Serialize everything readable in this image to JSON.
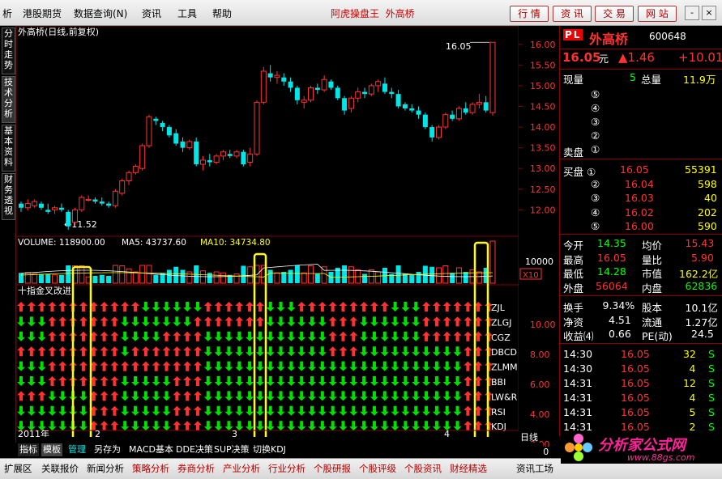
{
  "menu": {
    "items": [
      "析",
      "港股期货",
      "数据查询(N)",
      "资讯",
      "工具",
      "帮助"
    ],
    "title_left": "阿虎操盘王",
    "title_right": "外高桥",
    "buttons": [
      "行 情",
      "资 讯",
      "交 易",
      "网 站"
    ],
    "win_buttons": [
      "-",
      "×"
    ]
  },
  "left_tabs": [
    "分时走势",
    "技术分析",
    "基本资料",
    "财务透视"
  ],
  "chart": {
    "title": "外高桥(日线,前复权)",
    "high_label": "16.05",
    "low_label": "←11.52",
    "price_ticks": [
      "16.00",
      "15.50",
      "15.00",
      "14.50",
      "14.00",
      "13.50",
      "13.00",
      "12.50",
      "12.00"
    ],
    "volume_label": "VOLUME: 118900.00",
    "ma5_label": "MA5: 43737.60",
    "ma10_label": "MA10: 34734.80",
    "volume_tick": "10000",
    "volume_multiplier": "X10",
    "indicator_title": "十指金叉改进",
    "indicator_names": [
      "ZJL",
      "ZLGJ",
      "CGZ",
      "DBCD",
      "ZLMM",
      "BBI",
      "LW&R",
      "RSI",
      "KDJ"
    ],
    "indicator_ticks": [
      "10.00",
      "8.00",
      "6.00",
      "4.00",
      "2.00"
    ],
    "date_year": "2011年",
    "date_marks": [
      "2",
      "3",
      "4"
    ],
    "period": "日线",
    "nav_buttons": [
      "+",
      "-",
      "0"
    ]
  },
  "chart_data": {
    "type": "candlestick",
    "candles": [
      [
        12.15,
        12.2,
        11.95,
        12.05
      ],
      [
        12.05,
        12.25,
        11.98,
        12.15
      ],
      [
        12.1,
        12.25,
        12.05,
        12.2
      ],
      [
        12.15,
        12.2,
        12.0,
        12.05
      ],
      [
        12.0,
        12.15,
        11.9,
        11.95
      ],
      [
        12.0,
        12.1,
        11.9,
        12.05
      ],
      [
        12.05,
        12.15,
        11.95,
        12.0
      ],
      [
        11.95,
        12.0,
        11.52,
        11.6
      ],
      [
        11.7,
        12.05,
        11.65,
        12.0
      ],
      [
        12.0,
        12.35,
        11.95,
        12.3
      ],
      [
        12.25,
        12.35,
        12.2,
        12.25
      ],
      [
        12.25,
        12.3,
        12.15,
        12.2
      ],
      [
        12.2,
        12.3,
        12.1,
        12.15
      ],
      [
        12.15,
        12.2,
        12.05,
        12.1
      ],
      [
        12.1,
        12.5,
        12.05,
        12.45
      ],
      [
        12.4,
        12.75,
        12.35,
        12.7
      ],
      [
        12.7,
        12.95,
        12.6,
        12.9
      ],
      [
        12.9,
        13.1,
        12.85,
        13.05
      ],
      [
        13.0,
        13.6,
        12.95,
        13.55
      ],
      [
        13.55,
        14.3,
        13.5,
        14.25
      ],
      [
        14.2,
        14.25,
        14.05,
        14.15
      ],
      [
        14.1,
        14.15,
        13.9,
        14.0
      ],
      [
        14.0,
        14.05,
        13.75,
        13.8
      ],
      [
        13.85,
        13.95,
        13.55,
        13.6
      ],
      [
        13.65,
        13.75,
        13.4,
        13.5
      ],
      [
        13.5,
        13.7,
        13.45,
        13.65
      ],
      [
        13.65,
        13.75,
        13.05,
        13.1
      ],
      [
        13.1,
        13.3,
        12.95,
        13.2
      ],
      [
        13.2,
        13.35,
        13.05,
        13.15
      ],
      [
        13.15,
        13.35,
        13.1,
        13.3
      ],
      [
        13.3,
        13.45,
        13.2,
        13.4
      ],
      [
        13.35,
        13.45,
        13.25,
        13.3
      ],
      [
        13.3,
        13.45,
        13.25,
        13.4
      ],
      [
        13.4,
        13.45,
        13.05,
        13.1
      ],
      [
        13.15,
        13.5,
        13.05,
        13.35
      ],
      [
        13.35,
        14.65,
        13.3,
        14.6
      ],
      [
        14.6,
        15.45,
        14.55,
        15.35
      ],
      [
        15.3,
        15.5,
        15.1,
        15.2
      ],
      [
        15.2,
        15.35,
        15.05,
        15.25
      ],
      [
        15.2,
        15.3,
        15.0,
        15.1
      ],
      [
        15.1,
        15.2,
        14.85,
        14.95
      ],
      [
        14.95,
        15.0,
        14.55,
        14.65
      ],
      [
        14.6,
        14.75,
        14.45,
        14.65
      ],
      [
        14.65,
        15.0,
        14.6,
        14.95
      ],
      [
        14.95,
        15.05,
        14.8,
        14.9
      ],
      [
        14.9,
        15.25,
        14.85,
        15.15
      ],
      [
        15.1,
        15.15,
        14.9,
        14.95
      ],
      [
        14.95,
        15.0,
        14.65,
        14.7
      ],
      [
        14.7,
        14.75,
        14.3,
        14.4
      ],
      [
        14.45,
        14.75,
        14.35,
        14.7
      ],
      [
        14.7,
        14.95,
        14.6,
        14.85
      ],
      [
        14.85,
        14.95,
        14.7,
        14.8
      ],
      [
        14.8,
        15.05,
        14.75,
        15.0
      ],
      [
        15.0,
        15.15,
        14.85,
        15.1
      ],
      [
        15.05,
        15.2,
        14.8,
        14.85
      ],
      [
        14.85,
        14.95,
        14.7,
        14.8
      ],
      [
        14.8,
        14.9,
        14.45,
        14.5
      ],
      [
        14.55,
        14.6,
        14.4,
        14.45
      ],
      [
        14.45,
        14.55,
        14.35,
        14.4
      ],
      [
        14.4,
        14.5,
        14.2,
        14.3
      ],
      [
        14.3,
        14.35,
        13.95,
        14.0
      ],
      [
        14.0,
        14.05,
        13.65,
        13.75
      ],
      [
        13.75,
        14.05,
        13.7,
        14.0
      ],
      [
        14.0,
        14.35,
        13.95,
        14.3
      ],
      [
        14.3,
        14.4,
        14.15,
        14.2
      ],
      [
        14.2,
        14.5,
        14.15,
        14.45
      ],
      [
        14.45,
        14.6,
        14.3,
        14.35
      ],
      [
        14.35,
        14.6,
        14.3,
        14.55
      ],
      [
        14.55,
        14.8,
        14.45,
        14.6
      ],
      [
        14.6,
        14.75,
        14.35,
        14.4
      ],
      [
        14.35,
        16.05,
        14.28,
        16.05
      ]
    ],
    "volume_ylabel": "X10",
    "signal_rows": [
      "ZJL",
      "ZLGJ",
      "CGZ",
      "DBCD",
      "ZLMM",
      "BBI",
      "LW&R",
      "RSI",
      "KDJ"
    ]
  },
  "quote": {
    "code_badge": "PL",
    "name": "外高桥",
    "code": "600648",
    "price": "16.05",
    "price_unit": "元",
    "change": "▲1.46",
    "change_pct": "+10.01",
    "row1": {
      "l1": "现量",
      "v1": "5",
      "l2": "总量",
      "v2": "11.9万"
    },
    "sell_label": "卖盘",
    "sell_levels": [
      "⑤",
      "④",
      "③",
      "②",
      "①"
    ],
    "buy_label": "买盘",
    "buy_levels": [
      {
        "lv": "①",
        "price": "16.05",
        "vol": "55391"
      },
      {
        "lv": "②",
        "price": "16.04",
        "vol": "598"
      },
      {
        "lv": "③",
        "price": "16.03",
        "vol": "40"
      },
      {
        "lv": "④",
        "price": "16.02",
        "vol": "202"
      },
      {
        "lv": "⑤",
        "price": "16.00",
        "vol": "590"
      }
    ],
    "stats": [
      {
        "l1": "今开",
        "v1": "14.35",
        "l2": "均价",
        "v2": "15.43"
      },
      {
        "l1": "最高",
        "v1": "16.05",
        "l2": "量比",
        "v2": "5.90"
      },
      {
        "l1": "最低",
        "v1": "14.28",
        "l2": "市值",
        "v2": "162.2亿"
      },
      {
        "l1": "外盘",
        "v1": "56064",
        "l2": "内盘",
        "v2": "62836"
      }
    ],
    "fund": [
      {
        "l1": "换手",
        "v1": "9.34%",
        "l2": "股本",
        "v2": "10.1亿"
      },
      {
        "l1": "净资",
        "v1": "4.51",
        "l2": "流通",
        "v2": "1.27亿"
      },
      {
        "l1": "收益⑷",
        "v1": "0.66",
        "l2": "PE(动)",
        "v2": "24.5"
      }
    ],
    "ticks": [
      {
        "t": "14:30",
        "p": "16.05",
        "v": "32",
        "d": "S"
      },
      {
        "t": "14:30",
        "p": "16.05",
        "v": "4",
        "d": "S"
      },
      {
        "t": "14:31",
        "p": "16.05",
        "v": "12",
        "d": "S"
      },
      {
        "t": "14:31",
        "p": "16.05",
        "v": "4",
        "d": "S"
      },
      {
        "t": "14:31",
        "p": "16.05",
        "v": "5",
        "d": "S"
      },
      {
        "t": "14:31",
        "p": "16.05",
        "v": "2",
        "d": "S"
      }
    ]
  },
  "bottom_tabs": [
    "指标",
    "模板",
    "管理",
    "另存为",
    "MACD基本",
    "DDE决策",
    "SUP决策",
    "切换KDJ"
  ],
  "status": [
    "扩展区",
    "关联报价",
    "新闻分析",
    "策略分析",
    "券商分析",
    "产业分析",
    "行业分析",
    "个股研报",
    "个股评级",
    "个股资讯",
    "财经精选",
    "资讯工场"
  ],
  "logo": {
    "text": "分析家公式网",
    "url": "www.88gs.com"
  },
  "colors": {
    "up": "#ff3232",
    "down": "#00e6e6",
    "ma5": "#ffffff",
    "ma10": "#ffff00",
    "highlight": "#ffff00",
    "volume": "#00e6e6"
  }
}
